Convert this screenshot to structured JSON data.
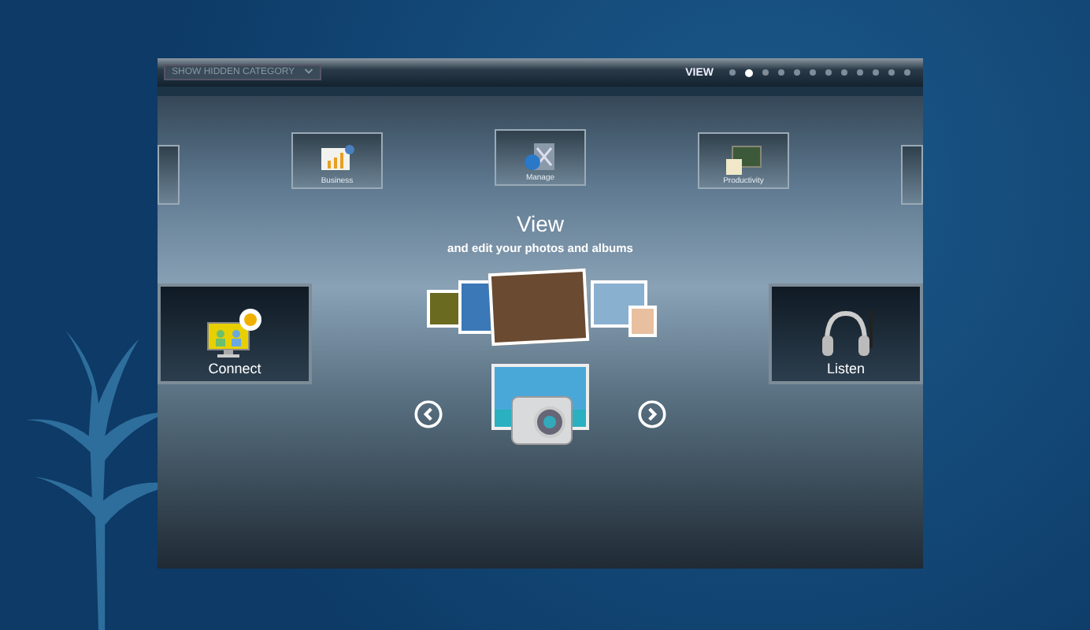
{
  "top_bar": {
    "dropdown": "SHOW HIDDEN CATEGORY",
    "view_label": "VIEW",
    "pages": [
      {
        "selected": false
      },
      {
        "selected": true
      },
      {
        "selected": false
      },
      {
        "selected": false
      },
      {
        "selected": false
      },
      {
        "selected": false
      },
      {
        "selected": false
      },
      {
        "selected": false
      },
      {
        "selected": false
      },
      {
        "selected": false
      },
      {
        "selected": false
      },
      {
        "selected": false
      }
    ]
  },
  "top_tiles": [
    {
      "kind": "partial"
    },
    {
      "kind": "chart",
      "label": "Business"
    },
    {
      "kind": "tools",
      "label": "Manage"
    },
    {
      "kind": "board",
      "label": "Productivity"
    },
    {
      "kind": "partial"
    }
  ],
  "feature": {
    "title": "View",
    "subtitle": "and edit your photos and albums"
  },
  "side_tiles": [
    {
      "kind": "connect",
      "label": "Connect"
    },
    {
      "kind": "listen",
      "label": "Listen"
    }
  ]
}
